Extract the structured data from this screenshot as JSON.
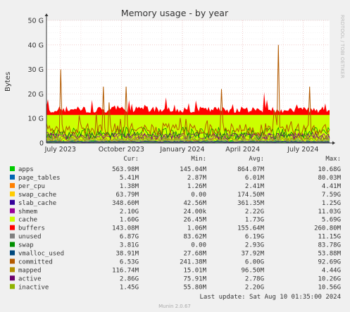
{
  "chart_data": {
    "type": "area",
    "title": "Memory usage - by year",
    "ylabel": "Bytes",
    "xlabel": "",
    "side_label": "RRDTOOL / TOBI OETIKER",
    "ylim": [
      0,
      50000000000
    ],
    "y_ticks": [
      "0",
      "10 G",
      "20 G",
      "30 G",
      "40 G",
      "50 G"
    ],
    "y_tick_values": [
      0,
      10,
      20,
      30,
      40,
      50
    ],
    "x_ticks": [
      "July 2023",
      "October 2023",
      "January 2024",
      "April 2024",
      "July 2024"
    ],
    "x_range": [
      "2023-06-10",
      "2024-08-10"
    ],
    "x_tick_dates": [
      "2023-07-01",
      "2023-10-01",
      "2024-01-01",
      "2024-04-01",
      "2024-07-01"
    ],
    "grid": true,
    "legend_placement": "bottom",
    "columns": [
      "Cur:",
      "Min:",
      "Avg:",
      "Max:"
    ],
    "series": [
      {
        "name": "apps",
        "color": "#00cc00",
        "cur": "563.98M",
        "min": "145.04M",
        "avg": "864.07M",
        "max": "10.68G"
      },
      {
        "name": "page_tables",
        "color": "#0066b3",
        "cur": "5.41M",
        "min": "2.87M",
        "avg": "6.01M",
        "max": "80.03M"
      },
      {
        "name": "per_cpu",
        "color": "#ff8000",
        "cur": "1.38M",
        "min": "1.26M",
        "avg": "2.41M",
        "max": "4.41M"
      },
      {
        "name": "swap_cache",
        "color": "#ffcc00",
        "cur": "63.79M",
        "min": "0.00",
        "avg": "174.50M",
        "max": "7.59G"
      },
      {
        "name": "slab_cache",
        "color": "#330099",
        "cur": "348.60M",
        "min": "42.56M",
        "avg": "361.35M",
        "max": "1.25G"
      },
      {
        "name": "shmem",
        "color": "#990099",
        "cur": "2.10G",
        "min": "24.00k",
        "avg": "2.22G",
        "max": "11.03G"
      },
      {
        "name": "cache",
        "color": "#ccff00",
        "cur": "1.60G",
        "min": "26.45M",
        "avg": "1.73G",
        "max": "5.69G"
      },
      {
        "name": "buffers",
        "color": "#ff0000",
        "cur": "143.08M",
        "min": "1.06M",
        "avg": "155.64M",
        "max": "260.80M"
      },
      {
        "name": "unused",
        "color": "#808080",
        "cur": "6.87G",
        "min": "83.62M",
        "avg": "6.19G",
        "max": "11.15G"
      },
      {
        "name": "swap",
        "color": "#008f00",
        "cur": "3.81G",
        "min": "0.00",
        "avg": "2.93G",
        "max": "83.78G"
      },
      {
        "name": "vmalloc_used",
        "color": "#00487d",
        "cur": "38.91M",
        "min": "27.68M",
        "avg": "37.92M",
        "max": "53.88M"
      },
      {
        "name": "committed",
        "color": "#b35a00",
        "cur": "6.53G",
        "min": "241.38M",
        "avg": "6.00G",
        "max": "92.69G"
      },
      {
        "name": "mapped",
        "color": "#b38f00",
        "cur": "116.74M",
        "min": "15.01M",
        "avg": "96.50M",
        "max": "4.44G"
      },
      {
        "name": "active",
        "color": "#6b006b",
        "cur": "2.86G",
        "min": "75.91M",
        "avg": "2.78G",
        "max": "10.26G"
      },
      {
        "name": "inactive",
        "color": "#8fb300",
        "cur": "1.45G",
        "min": "55.80M",
        "avg": "2.20G",
        "max": "10.56G"
      }
    ],
    "last_update": "Last update: Sat Aug 10 01:35:00 2024",
    "footer": "Munin 2.0.67"
  }
}
